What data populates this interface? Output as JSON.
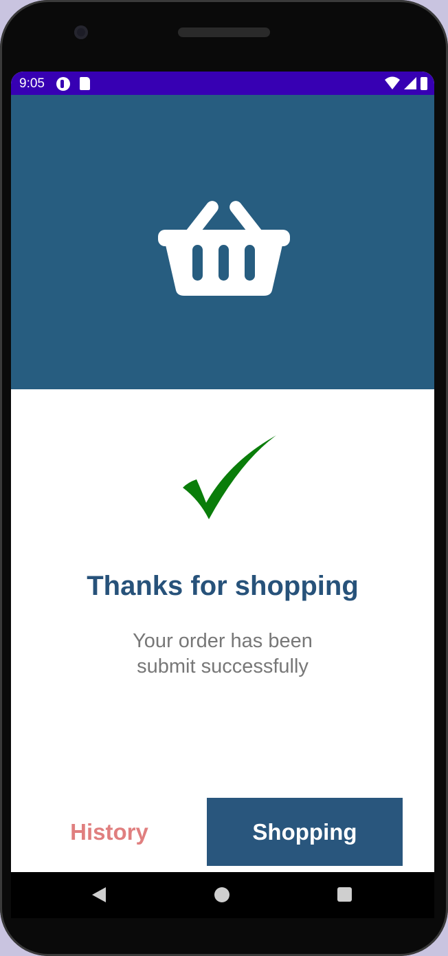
{
  "status_bar": {
    "time": "9:05",
    "left_icons": [
      "app-notification-icon",
      "sd-card-icon"
    ],
    "right_icons": [
      "wifi-icon",
      "signal-icon",
      "battery-icon"
    ],
    "background_color": "#3700b3"
  },
  "hero": {
    "icon": "shopping-basket-icon",
    "background_color": "#275d80"
  },
  "confirmation": {
    "icon": "checkmark-icon",
    "icon_color": "#0a7d0a",
    "title": "Thanks for shopping",
    "message_line1": "Your order has been",
    "message_line2": "submit successfully"
  },
  "actions": {
    "history_label": "History",
    "shopping_label": "Shopping",
    "history_color": "#e07f7f",
    "shopping_bg": "#29567d"
  },
  "navigation_bar": {
    "buttons": [
      "back-icon",
      "home-icon",
      "recents-icon"
    ]
  }
}
